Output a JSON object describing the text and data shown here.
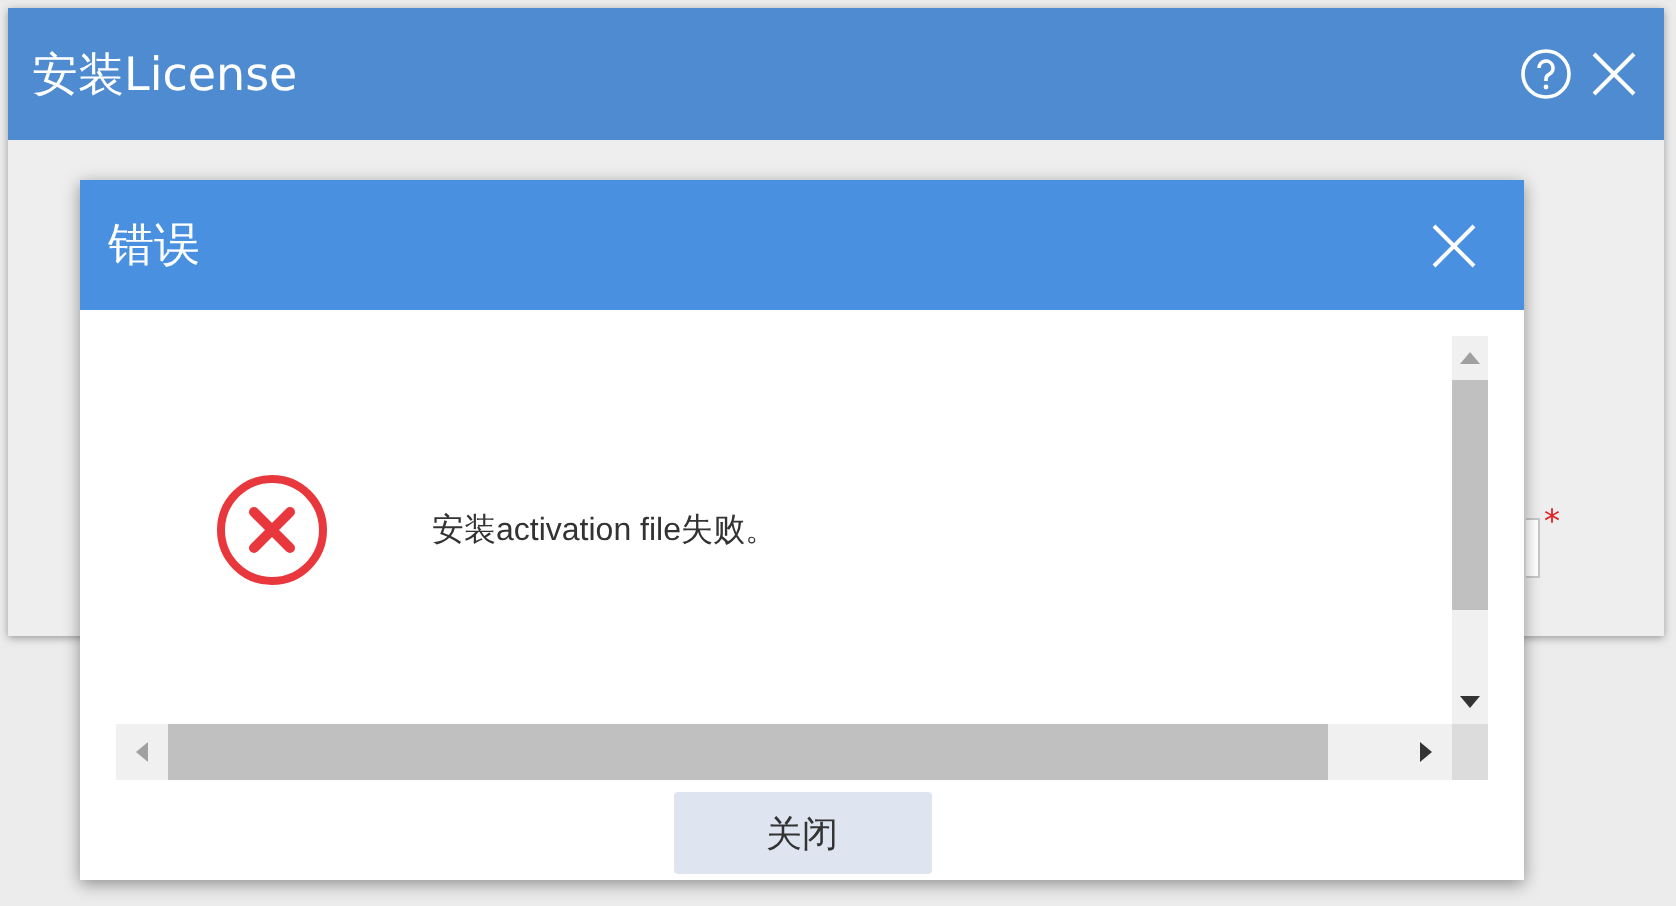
{
  "window": {
    "title": "安装License",
    "required_mark": "*"
  },
  "dialog": {
    "title": "错误",
    "message": "安装activation file失败。",
    "buttons": [
      "关闭"
    ]
  }
}
